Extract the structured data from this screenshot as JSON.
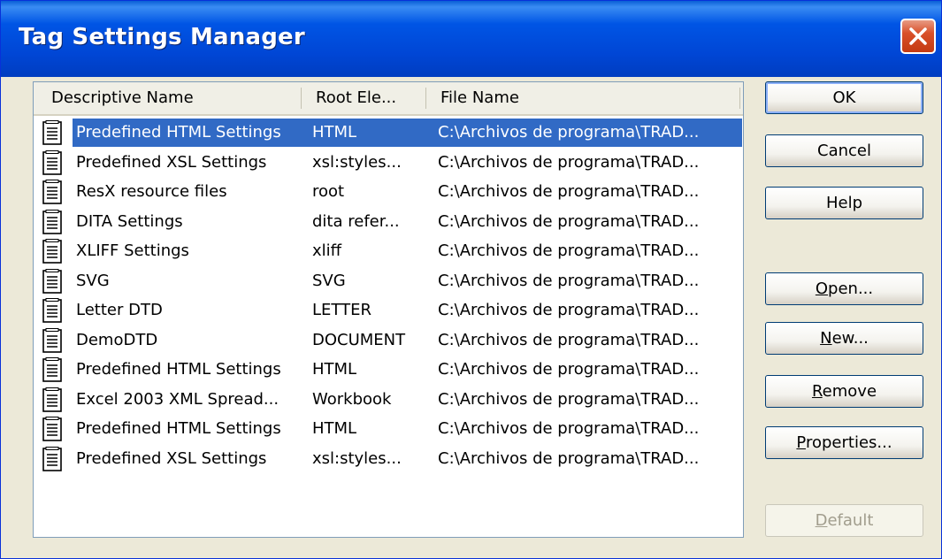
{
  "window": {
    "title": "Tag Settings Manager"
  },
  "columns": [
    "Descriptive Name",
    "Root Ele...",
    "File Name"
  ],
  "rows": [
    {
      "name": "Predefined HTML Settings",
      "root": "HTML",
      "file": "C:\\Archivos de programa\\TRAD...",
      "selected": true
    },
    {
      "name": "Predefined XSL Settings",
      "root": "xsl:styles...",
      "file": "C:\\Archivos de programa\\TRAD..."
    },
    {
      "name": "ResX resource files",
      "root": "root",
      "file": "C:\\Archivos de programa\\TRAD..."
    },
    {
      "name": "DITA Settings",
      "root": "dita refer...",
      "file": "C:\\Archivos de programa\\TRAD..."
    },
    {
      "name": "XLIFF Settings",
      "root": "xliff",
      "file": "C:\\Archivos de programa\\TRAD..."
    },
    {
      "name": "SVG",
      "root": "SVG",
      "file": "C:\\Archivos de programa\\TRAD..."
    },
    {
      "name": "Letter DTD",
      "root": "LETTER",
      "file": "C:\\Archivos de programa\\TRAD..."
    },
    {
      "name": "DemoDTD",
      "root": "DOCUMENT",
      "file": "C:\\Archivos de programa\\TRAD..."
    },
    {
      "name": "Predefined HTML Settings",
      "root": "HTML",
      "file": "C:\\Archivos de programa\\TRAD..."
    },
    {
      "name": "Excel 2003 XML Spread...",
      "root": "Workbook",
      "file": "C:\\Archivos de programa\\TRAD..."
    },
    {
      "name": "Predefined HTML Settings",
      "root": "HTML",
      "file": "C:\\Archivos de programa\\TRAD..."
    },
    {
      "name": "Predefined XSL Settings",
      "root": "xsl:styles...",
      "file": "C:\\Archivos de programa\\TRAD..."
    }
  ],
  "buttons": {
    "ok": "OK",
    "cancel": "Cancel",
    "help": "Help",
    "open": {
      "accel": "O",
      "rest": "pen..."
    },
    "new": {
      "accel": "N",
      "rest": "ew..."
    },
    "remove": {
      "accel": "R",
      "rest": "emove"
    },
    "properties": {
      "accel": "P",
      "rest": "roperties..."
    },
    "default": {
      "accel": "D",
      "rest": "efault"
    }
  },
  "colors": {
    "titlebar": "#0055e5",
    "selection": "#316ac5",
    "dialog": "#ece9d8"
  },
  "icons": {
    "list_item": "document-icon",
    "close": "close-icon"
  }
}
